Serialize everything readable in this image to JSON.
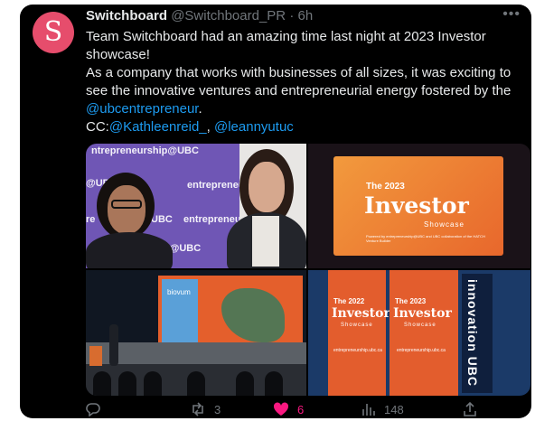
{
  "tweet": {
    "avatar_letter": "S",
    "display_name": "Switchboard",
    "handle": "@Switchboard_PR",
    "separator": "·",
    "time": "6h",
    "more_icon": "•••",
    "line1": "Team Switchboard had an amazing time last night at 2023 Investor showcase!",
    "line2": "As a company that works with businesses of all sizes, it was exciting to see the innovative ventures and entrepreneurial energy fostered by the",
    "mention1": "@ubcentrepreneur",
    "period": ".",
    "cc_label": "CC:",
    "mention2": "@Kathleenreid_",
    "comma": ",",
    "mention3": "@leannyutuc"
  },
  "media": {
    "photo1": {
      "wall_texts": [
        "ntrepreneurship@UBC",
        "entre",
        "@UBC",
        "entrepreneurship@UB",
        "re",
        "UBC",
        "entrepreneu",
        "ship@UBC"
      ]
    },
    "photo2": {
      "the": "The 2023",
      "title": "Investor",
      "sub": "Showcase",
      "fine": "Powered by entrepreneurship@UBC and UBC collaboration of the HATCH Venture Builder"
    },
    "photo3": {
      "screen_label": "biovum"
    },
    "photo4": {
      "left_year": "The 2022",
      "left_title": "Investor",
      "left_sub": "Showcase",
      "left_url": "entrepreneurship.ubc.ca",
      "right_year": "The 2023",
      "right_title": "Investor",
      "right_sub": "Showcase",
      "right_url": "entrepreneurship.ubc.ca",
      "side_banner": "innovation UBC"
    }
  },
  "actions": {
    "reply_count": "",
    "retweet_count": "3",
    "like_count": "6",
    "views_count": "148"
  },
  "colors": {
    "background": "#000000",
    "link": "#1d9bf0",
    "muted": "#71767b",
    "like": "#f91880",
    "avatar": "#e64d6c"
  }
}
